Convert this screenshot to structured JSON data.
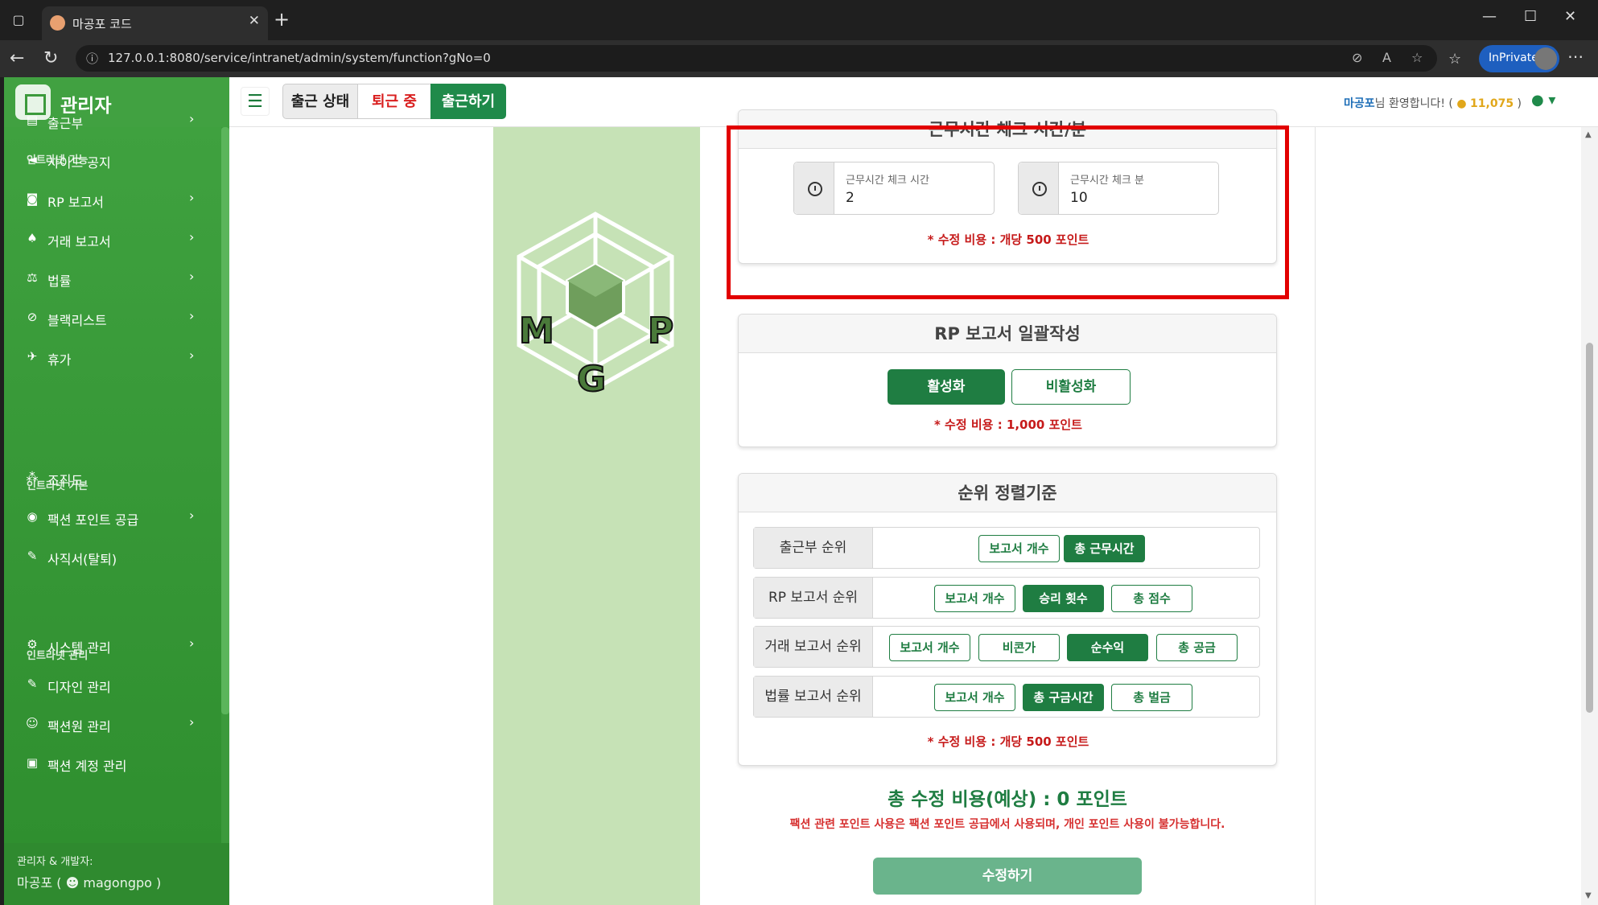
{
  "browser": {
    "tab_title": "마공포 코드",
    "url": "127.0.0.1:8080/service/intranet/admin/system/function?gNo=0",
    "inprivate_label": "InPrivate"
  },
  "sidebar": {
    "brand": "관리자",
    "sections": [
      {
        "title": "인트라넷 기능"
      },
      {
        "title": "인트라넷 기본"
      },
      {
        "title": "인트라넷 관리"
      }
    ],
    "items": [
      {
        "label": "출근부",
        "icon": "book-icon",
        "glyph": "▤",
        "chevron": true
      },
      {
        "label": "사이드 공지",
        "icon": "megaphone-icon",
        "glyph": "◄",
        "chevron": false
      },
      {
        "label": "RP 보고서",
        "icon": "gamepad-icon",
        "glyph": "◙",
        "chevron": true
      },
      {
        "label": "거래 보고서",
        "icon": "money-bag-icon",
        "glyph": "♠",
        "chevron": true
      },
      {
        "label": "법률",
        "icon": "scale-icon",
        "glyph": "⚖",
        "chevron": true
      },
      {
        "label": "블랙리스트",
        "icon": "ban-icon",
        "glyph": "⊘",
        "chevron": true
      },
      {
        "label": "휴가",
        "icon": "plane-icon",
        "glyph": "✈",
        "chevron": true
      },
      {
        "label": "조직도",
        "icon": "sitemap-icon",
        "glyph": "⁂",
        "chevron": false
      },
      {
        "label": "팩션 포인트 공급",
        "icon": "coins-icon",
        "glyph": "◉",
        "chevron": true
      },
      {
        "label": "사직서(탈퇴)",
        "icon": "pen-icon",
        "glyph": "✎",
        "chevron": false
      },
      {
        "label": "시스템 관리",
        "icon": "gear-icon",
        "glyph": "⚙",
        "chevron": true
      },
      {
        "label": "디자인 관리",
        "icon": "brush-icon",
        "glyph": "✎",
        "chevron": false
      },
      {
        "label": "팩션원 관리",
        "icon": "users-gear-icon",
        "glyph": "☺",
        "chevron": true
      },
      {
        "label": "팩션 계정 관리",
        "icon": "id-card-icon",
        "glyph": "▣",
        "chevron": false
      }
    ],
    "footer": {
      "role": "관리자 & 개발자:",
      "name": "마공포 ( ",
      "discord": "magongpo )"
    }
  },
  "topbar": {
    "status_label": "출근 상태",
    "status_off": "퇴근 중",
    "checkin_button": "출근하기",
    "welcome_name": "마공포",
    "welcome_text": "님 환영합니다! (",
    "points": "11,075",
    "welcome_close": " )"
  },
  "worktime": {
    "title": "근무시간 체크 시간/분",
    "hour_label": "근무시간 체크 시간",
    "hour_value": "2",
    "minute_label": "근무시간 체크 분",
    "minute_value": "10",
    "cost": "* 수정 비용 : 개당 500 포인트"
  },
  "rp_bulk": {
    "title": "RP 보고서 일괄작성",
    "activate": "활성화",
    "deactivate": "비활성화",
    "selected": "activate",
    "cost": "* 수정 비용 : 1,000 포인트"
  },
  "ranking": {
    "title": "순위 정렬기준",
    "rows": [
      {
        "label": "출근부 순위",
        "options": [
          "보고서 개수",
          "총 근무시간"
        ],
        "selected": 1
      },
      {
        "label": "RP 보고서 순위",
        "options": [
          "보고서 개수",
          "승리 횟수",
          "총 점수"
        ],
        "selected": 1
      },
      {
        "label": "거래 보고서 순위",
        "options": [
          "보고서 개수",
          "비콘가",
          "순수익",
          "총 공금"
        ],
        "selected": 2
      },
      {
        "label": "법률 보고서 순위",
        "options": [
          "보고서 개수",
          "총 구금시간",
          "총 벌금"
        ],
        "selected": 1
      }
    ],
    "cost": "* 수정 비용 : 개당 500 포인트"
  },
  "summary": {
    "total": "총 수정 비용(예상) : 0 포인트",
    "note": "팩션 관련 포인트 사용은 팩션 포인트 공급에서 사용되며, 개인 포인트 사용이 불가능합니다.",
    "submit": "수정하기"
  },
  "colors": {
    "primary": "#1f7d42",
    "sidebar": "#3c9a3c",
    "danger": "#c61a1a",
    "highlight": "#e20000"
  }
}
